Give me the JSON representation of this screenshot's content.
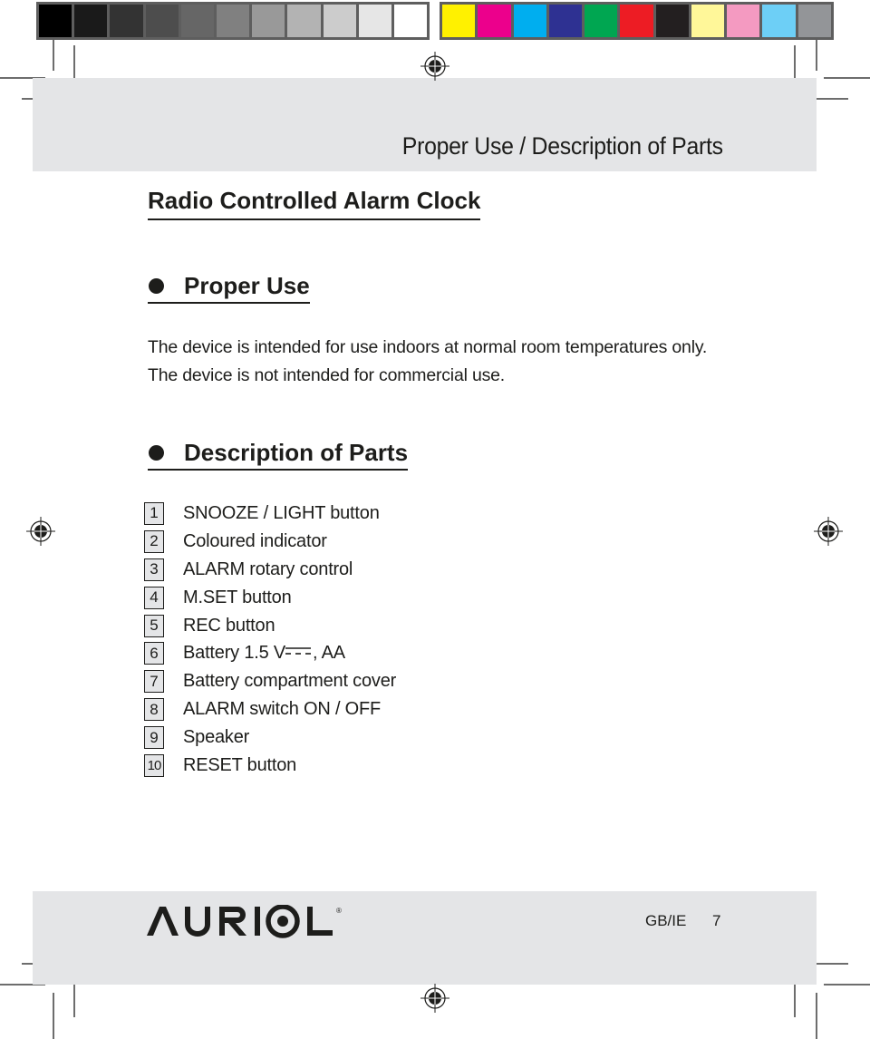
{
  "print_marks": {
    "grayscale_swatches": [
      "#000000",
      "#1a1a1a",
      "#333333",
      "#4d4d4d",
      "#666666",
      "#808080",
      "#999999",
      "#b3b3b3",
      "#cccccc",
      "#e6e6e6",
      "#ffffff"
    ],
    "color_swatches": [
      "#fff100",
      "#ec008c",
      "#00aeef",
      "#2e3192",
      "#00a651",
      "#ed1c24",
      "#231f20",
      "#fff799",
      "#f49ac1",
      "#6dcff6",
      "#939598"
    ],
    "registration_mark_icon": "registration-crosshair"
  },
  "header": {
    "section_title": "Proper Use / Description of Parts"
  },
  "document": {
    "title": "Radio Controlled Alarm Clock",
    "sections": {
      "proper_use": {
        "heading": "Proper Use",
        "body": "The device is intended for use indoors at normal room temperatures only. The device is not intended for commercial use."
      },
      "description_of_parts": {
        "heading": "Description of Parts",
        "parts": [
          {
            "number": "1",
            "label": "SNOOZE / LIGHT button"
          },
          {
            "number": "2",
            "label": "Coloured indicator"
          },
          {
            "number": "3",
            "label": "ALARM rotary control"
          },
          {
            "number": "4",
            "label": "M.SET button"
          },
          {
            "number": "5",
            "label": "REC button"
          },
          {
            "number": "6",
            "label": "Battery 1.5 V",
            "suffix": ", AA",
            "symbol": "dc-current-symbol"
          },
          {
            "number": "7",
            "label": "Battery compartment cover"
          },
          {
            "number": "8",
            "label": "ALARM switch ON / OFF"
          },
          {
            "number": "9",
            "label": "Speaker"
          },
          {
            "number": "10",
            "label": "RESET button"
          }
        ]
      }
    }
  },
  "footer": {
    "brand": "AURIOL",
    "registered_mark": "®",
    "locale": "GB/IE",
    "page_number": "7"
  },
  "colors": {
    "band_gray": "#e4e5e7",
    "text": "#1d1d1b"
  }
}
